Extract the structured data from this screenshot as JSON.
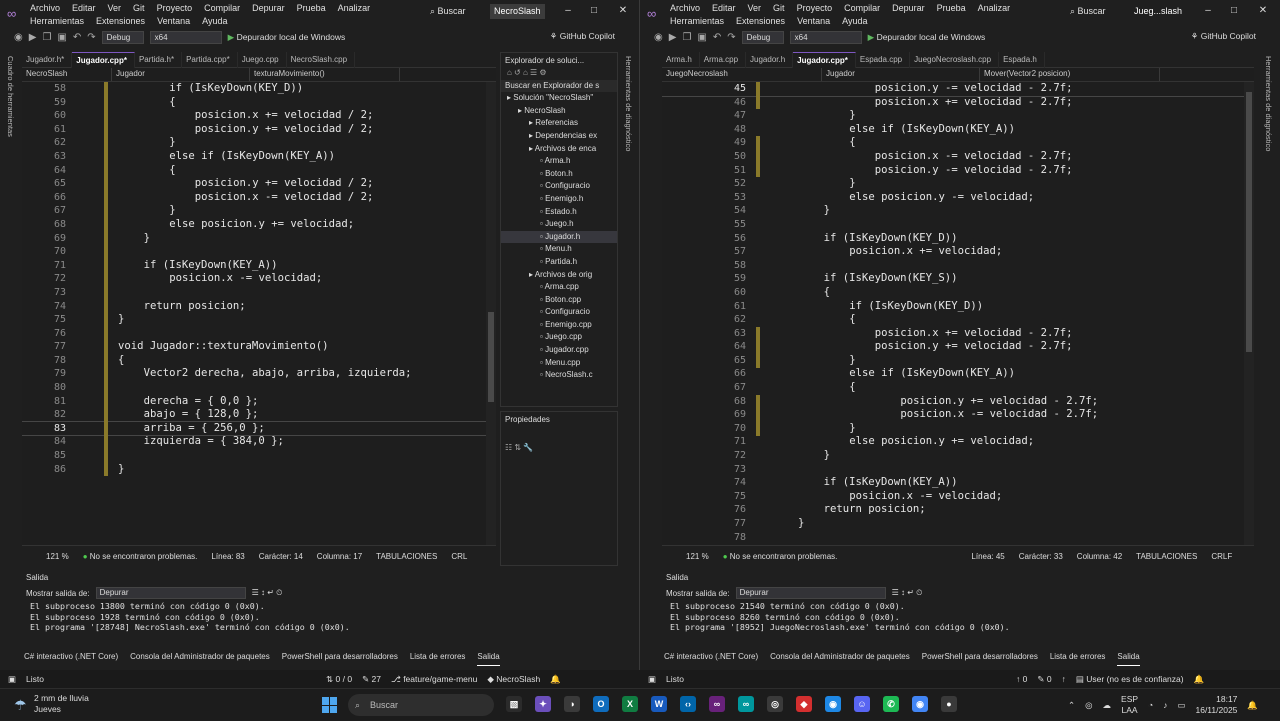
{
  "left": {
    "menu": [
      "Archivo",
      "Editar",
      "Ver",
      "Git",
      "Proyecto",
      "Compilar",
      "Depurar",
      "Prueba",
      "Analizar",
      "Herramientas",
      "Extensiones",
      "Ventana",
      "Ayuda"
    ],
    "search_label": "Buscar",
    "window_title": "NecroSlash",
    "toolbar": {
      "config": "Debug",
      "platform": "x64",
      "run_label": "Depurador local de Windows",
      "copilot": "GitHub Copilot"
    },
    "side_label_left": "Cuadro de herramientas",
    "side_label_right": "Herramientas de diagnóstico",
    "tabs": [
      "Jugador.h*",
      "Jugador.cpp*",
      "Partida.h*",
      "Partida.cpp*",
      "Juego.cpp",
      "NecroSlash.cpp"
    ],
    "nav": [
      "NecroSlash",
      "Jugador",
      "texturaMovimiento()"
    ],
    "code": [
      {
        "n": "58",
        "i": 8,
        "t": "if (IsKeyDown(KEY_D))"
      },
      {
        "n": "59",
        "i": 8,
        "t": "{"
      },
      {
        "n": "60",
        "i": 12,
        "t": "posicion.x += velocidad / 2;"
      },
      {
        "n": "61",
        "i": 12,
        "t": "posicion.y += velocidad / 2;"
      },
      {
        "n": "62",
        "i": 8,
        "t": "}"
      },
      {
        "n": "63",
        "i": 8,
        "t": "else if (IsKeyDown(KEY_A))"
      },
      {
        "n": "64",
        "i": 8,
        "t": "{"
      },
      {
        "n": "65",
        "i": 12,
        "t": "posicion.y += velocidad / 2;"
      },
      {
        "n": "66",
        "i": 12,
        "t": "posicion.x -= velocidad / 2;"
      },
      {
        "n": "67",
        "i": 8,
        "t": "}"
      },
      {
        "n": "68",
        "i": 8,
        "t": "else posicion.y += velocidad;"
      },
      {
        "n": "69",
        "i": 4,
        "t": "}"
      },
      {
        "n": "70",
        "i": 0,
        "t": ""
      },
      {
        "n": "71",
        "i": 4,
        "t": "if (IsKeyDown(KEY_A))"
      },
      {
        "n": "72",
        "i": 8,
        "t": "posicion.x -= velocidad;"
      },
      {
        "n": "73",
        "i": 0,
        "t": ""
      },
      {
        "n": "74",
        "i": 4,
        "t": "return posicion;"
      },
      {
        "n": "75",
        "i": 0,
        "t": "}"
      },
      {
        "n": "76",
        "i": 0,
        "t": ""
      },
      {
        "n": "77",
        "i": 0,
        "t": "void Jugador::texturaMovimiento()"
      },
      {
        "n": "78",
        "i": 0,
        "t": "{"
      },
      {
        "n": "79",
        "i": 4,
        "t": "Vector2 derecha, abajo, arriba, izquierda;"
      },
      {
        "n": "80",
        "i": 0,
        "t": ""
      },
      {
        "n": "81",
        "i": 4,
        "t": "derecha = { 0,0 };"
      },
      {
        "n": "82",
        "i": 4,
        "t": "abajo = { 128,0 };"
      },
      {
        "n": "83",
        "i": 4,
        "t": "arriba = { 256,0 };"
      },
      {
        "n": "84",
        "i": 4,
        "t": "izquierda = { 384,0 };"
      },
      {
        "n": "85",
        "i": 0,
        "t": ""
      },
      {
        "n": "86",
        "i": 0,
        "t": "}"
      }
    ],
    "status": {
      "zoom": "121 %",
      "problems": "No se encontraron problemas.",
      "line": "Línea: 83",
      "char": "Carácter: 14",
      "col": "Columna: 17",
      "tabs": "TABULACIONES",
      "eol": "CRL"
    },
    "solution": {
      "title": "Explorador de soluci...",
      "search": "Buscar en Explorador de s",
      "items": [
        "Solución \"NecroSlash\"",
        "NecroSlash",
        "Referencias",
        "Dependencias ex",
        "Archivos de enca",
        "Arma.h",
        "Boton.h",
        "Configuracio",
        "Enemigo.h",
        "Estado.h",
        "Juego.h",
        "Jugador.h",
        "Menu.h",
        "Partida.h",
        "Archivos de orig",
        "Arma.cpp",
        "Boton.cpp",
        "Configuracio",
        "Enemigo.cpp",
        "Juego.cpp",
        "Jugador.cpp",
        "Menu.cpp",
        "NecroSlash.c"
      ]
    },
    "properties_title": "Propiedades",
    "output": {
      "title": "Salida",
      "show_label": "Mostrar salida de:",
      "source": "Depurar",
      "lines": [
        "El subproceso 13800 terminó con código 0 (0x0).",
        "El subproceso 1928 terminó con código 0 (0x0).",
        "El programa '[28748] NecroSlash.exe' terminó con código 0 (0x0)."
      ],
      "tabs": [
        "C# interactivo (.NET Core)",
        "Consola del Administrador de paquetes",
        "PowerShell para desarrolladores",
        "Lista de errores",
        "Salida"
      ]
    },
    "statusbar": {
      "ready": "Listo",
      "changes": "0 / 0",
      "commits": "27",
      "branch": "feature/game-menu",
      "repo": "NecroSlash"
    }
  },
  "right": {
    "menu": [
      "Archivo",
      "Editar",
      "Ver",
      "Git",
      "Proyecto",
      "Compilar",
      "Depurar",
      "Prueba",
      "Analizar",
      "Herramientas",
      "Extensiones",
      "Ventana",
      "Ayuda"
    ],
    "search_label": "Buscar",
    "window_title": "Jueg...slash",
    "toolbar": {
      "config": "Debug",
      "platform": "x64",
      "run_label": "Depurador local de Windows",
      "copilot": "GitHub Copilot"
    },
    "side_label_right": "Herramientas de diagnóstico",
    "tabs": [
      "Arma.h",
      "Arma.cpp",
      "Jugador.h",
      "Jugador.cpp*",
      "Espada.cpp",
      "JuegoNecroslash.cpp",
      "Espada.h"
    ],
    "nav": [
      "JuegoNecroslash",
      "Jugador",
      "Mover(Vector2 posicion)"
    ],
    "code": [
      {
        "n": "45",
        "i": 12,
        "t": "posicion.y -= velocidad - 2.7f;"
      },
      {
        "n": "46",
        "i": 12,
        "t": "posicion.x += velocidad - 2.7f;"
      },
      {
        "n": "47",
        "i": 8,
        "t": "}"
      },
      {
        "n": "48",
        "i": 8,
        "t": "else if (IsKeyDown(KEY_A))"
      },
      {
        "n": "49",
        "i": 8,
        "t": "{"
      },
      {
        "n": "50",
        "i": 12,
        "t": "posicion.x -= velocidad - 2.7f;"
      },
      {
        "n": "51",
        "i": 12,
        "t": "posicion.y -= velocidad - 2.7f;"
      },
      {
        "n": "52",
        "i": 8,
        "t": "}"
      },
      {
        "n": "53",
        "i": 8,
        "t": "else posicion.y -= velocidad;"
      },
      {
        "n": "54",
        "i": 4,
        "t": "}"
      },
      {
        "n": "55",
        "i": 0,
        "t": ""
      },
      {
        "n": "56",
        "i": 4,
        "t": "if (IsKeyDown(KEY_D))"
      },
      {
        "n": "57",
        "i": 8,
        "t": "posicion.x += velocidad;"
      },
      {
        "n": "58",
        "i": 0,
        "t": ""
      },
      {
        "n": "59",
        "i": 4,
        "t": "if (IsKeyDown(KEY_S))"
      },
      {
        "n": "60",
        "i": 4,
        "t": "{"
      },
      {
        "n": "61",
        "i": 8,
        "t": "if (IsKeyDown(KEY_D))"
      },
      {
        "n": "62",
        "i": 8,
        "t": "{"
      },
      {
        "n": "63",
        "i": 12,
        "t": "posicion.x += velocidad - 2.7f;"
      },
      {
        "n": "64",
        "i": 12,
        "t": "posicion.y += velocidad - 2.7f;"
      },
      {
        "n": "65",
        "i": 8,
        "t": "}"
      },
      {
        "n": "66",
        "i": 8,
        "t": "else if (IsKeyDown(KEY_A))"
      },
      {
        "n": "67",
        "i": 8,
        "t": "{"
      },
      {
        "n": "68",
        "i": 16,
        "t": "posicion.y += velocidad - 2.7f;"
      },
      {
        "n": "69",
        "i": 16,
        "t": "posicion.x -= velocidad - 2.7f;"
      },
      {
        "n": "70",
        "i": 8,
        "t": "}"
      },
      {
        "n": "71",
        "i": 8,
        "t": "else posicion.y += velocidad;"
      },
      {
        "n": "72",
        "i": 4,
        "t": "}"
      },
      {
        "n": "73",
        "i": 0,
        "t": ""
      },
      {
        "n": "74",
        "i": 4,
        "t": "if (IsKeyDown(KEY_A))"
      },
      {
        "n": "75",
        "i": 8,
        "t": "posicion.x -= velocidad;"
      },
      {
        "n": "76",
        "i": 4,
        "t": "return posicion;"
      },
      {
        "n": "77",
        "i": 0,
        "t": "}"
      },
      {
        "n": "78",
        "i": 0,
        "t": ""
      }
    ],
    "status": {
      "zoom": "121 %",
      "problems": "No se encontraron problemas.",
      "line": "Línea: 45",
      "char": "Carácter: 33",
      "col": "Columna: 42",
      "tabs": "TABULACIONES",
      "eol": "CRLF"
    },
    "output": {
      "title": "Salida",
      "show_label": "Mostrar salida de:",
      "source": "Depurar",
      "lines": [
        "El subproceso 21540 terminó con código 0 (0x0).",
        "El subproceso 8260 terminó con código 0 (0x0).",
        "El programa '[8952] JuegoNecroslash.exe' terminó con código 0 (0x0)."
      ],
      "tabs": [
        "C# interactivo (.NET Core)",
        "Consola del Administrador de paquetes",
        "PowerShell para desarrolladores",
        "Lista de errores",
        "Salida"
      ]
    },
    "statusbar": {
      "ready": "Listo",
      "up": "0",
      "pencil": "0",
      "trust": "User (no es de confianza)"
    }
  },
  "taskbar": {
    "weather_line1": "2 mm de lluvia",
    "weather_line2": "Jueves",
    "search": "Buscar",
    "lang1": "ESP",
    "lang2": "LAA",
    "time": "18:17",
    "date": "16/11/2025"
  }
}
